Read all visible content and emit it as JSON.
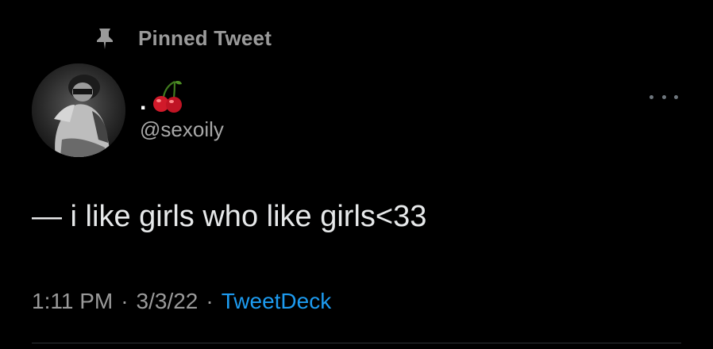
{
  "pinned": {
    "label": "Pinned Tweet",
    "icon": "pin-icon"
  },
  "author": {
    "display_name": ".",
    "display_name_emoji": "cherries-icon",
    "handle": "@sexoily",
    "avatar": "avatar"
  },
  "tweet": {
    "text": "— i like girls who like girls<33"
  },
  "meta": {
    "time": "1:11 PM",
    "separator": "·",
    "date": "3/3/22",
    "source": "TweetDeck"
  },
  "more_menu": {
    "icon": "more-icon"
  },
  "colors": {
    "background": "#000000",
    "primary_text": "#e7e9ea",
    "secondary_text": "#9a9a9a",
    "link": "#1d9bf0",
    "cherry_red": "#d11a2a"
  }
}
